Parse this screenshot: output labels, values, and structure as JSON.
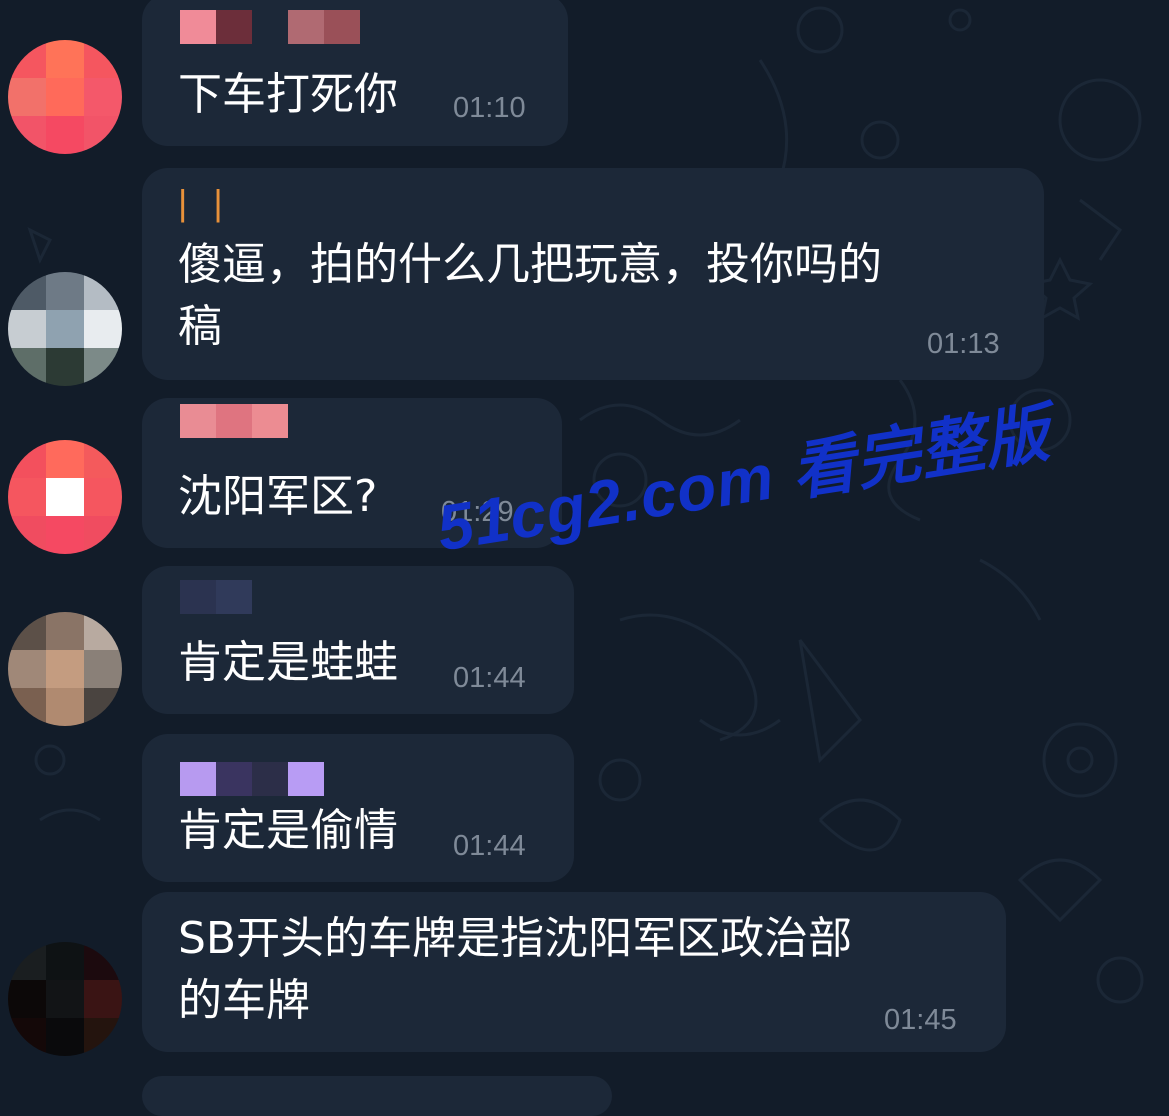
{
  "messages": [
    {
      "text": "下车打死你",
      "time": "01:10"
    },
    {
      "sender": "| |",
      "text": "傻逼，拍的什么几把玩意，投你吗的\n稿",
      "time": "01:13"
    },
    {
      "text": "沈阳军区?",
      "time": "01:29"
    },
    {
      "text": "肯定是蛙蛙",
      "time": "01:44"
    },
    {
      "text": "肯定是偷情",
      "time": "01:44"
    },
    {
      "text": "SB开头的车牌是指沈阳军区政治部\n的车牌",
      "time": "01:45"
    }
  ],
  "watermark": "51cg2.com 看完整版",
  "colors": {
    "background": "#121c29",
    "bubble": "#1c2838",
    "text": "#ffffff",
    "time": "#7f8a98",
    "watermark": "#1131c8",
    "sender_orange": "#e8913a"
  }
}
